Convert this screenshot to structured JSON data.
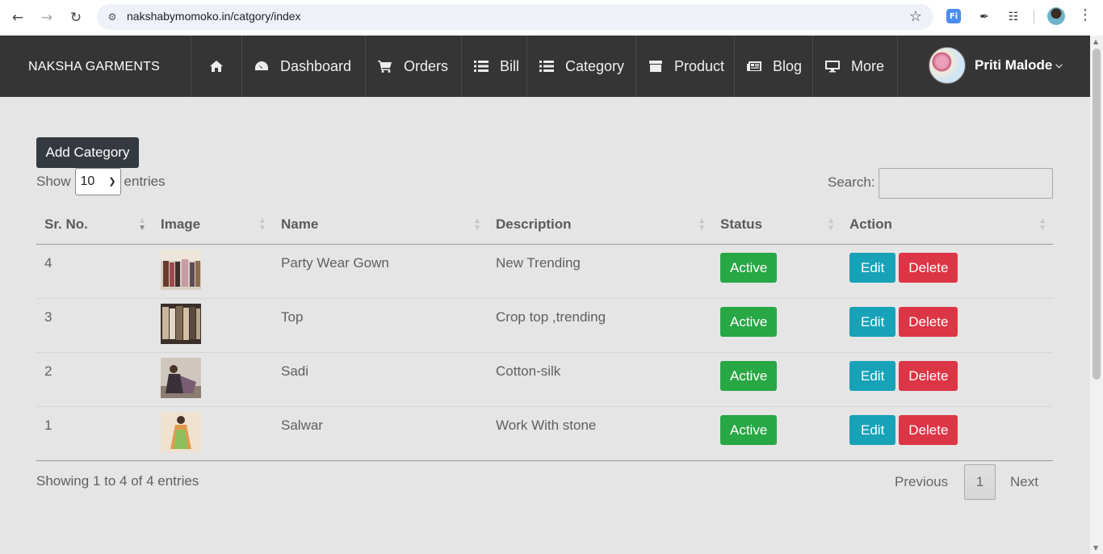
{
  "browser": {
    "url": "nakshabymomoko.in/catgory/index",
    "ext_fi_label": "Fi"
  },
  "nav": {
    "brand": "NAKSHA GARMENTS",
    "items": [
      {
        "label": "",
        "icon": "home-icon"
      },
      {
        "label": "Dashboard",
        "icon": "dashboard-icon"
      },
      {
        "label": "Orders",
        "icon": "cart-icon"
      },
      {
        "label": "Bill",
        "icon": "list-icon"
      },
      {
        "label": "Category",
        "icon": "list-icon"
      },
      {
        "label": "Product",
        "icon": "box-icon"
      },
      {
        "label": "Blog",
        "icon": "newspaper-icon"
      },
      {
        "label": "More",
        "icon": "desktop-icon"
      }
    ],
    "user_name": "Priti Malode"
  },
  "content": {
    "add_button": "Add Category",
    "show_label": "Show",
    "entries_value": "10",
    "entries_label": "entries",
    "search_label": "Search:",
    "search_value": ""
  },
  "table": {
    "headers": [
      "Sr. No.",
      "Image",
      "Name",
      "Description",
      "Status",
      "Action"
    ],
    "rows": [
      {
        "sr": "4",
        "name": "Party Wear Gown",
        "description": "New Trending",
        "status": "Active",
        "edit": "Edit",
        "delete": "Delete"
      },
      {
        "sr": "3",
        "name": "Top",
        "description": "Crop top ,trending",
        "status": "Active",
        "edit": "Edit",
        "delete": "Delete"
      },
      {
        "sr": "2",
        "name": "Sadi",
        "description": "Cotton-silk",
        "status": "Active",
        "edit": "Edit",
        "delete": "Delete"
      },
      {
        "sr": "1",
        "name": "Salwar",
        "description": "Work With stone",
        "status": "Active",
        "edit": "Edit",
        "delete": "Delete"
      }
    ]
  },
  "footer": {
    "info": "Showing 1 to 4 of 4 entries",
    "previous": "Previous",
    "page": "1",
    "next": "Next"
  },
  "colors": {
    "navbar": "#353535",
    "active": "#28a745",
    "edit": "#17a2b8",
    "delete": "#dc3545",
    "add_button": "#343a40"
  }
}
